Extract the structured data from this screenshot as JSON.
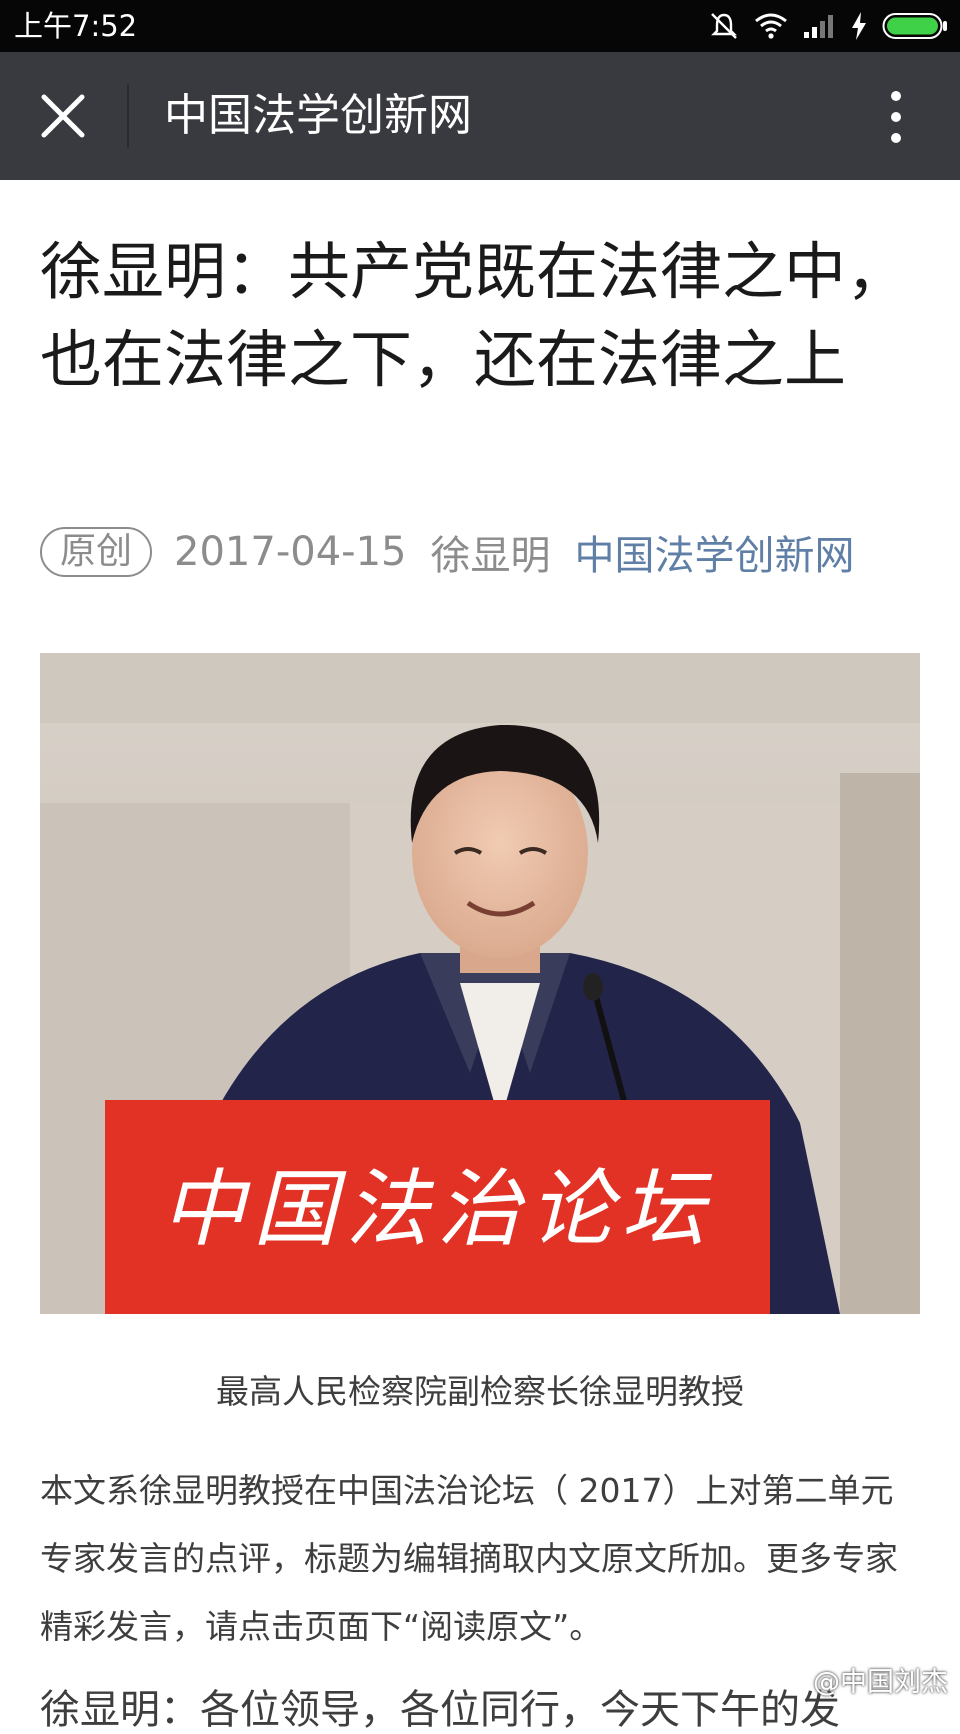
{
  "status_bar": {
    "time": "上午7:52",
    "icons": [
      "mute-vibrate-icon",
      "wifi-icon",
      "signal-icon",
      "charging-icon",
      "battery-icon"
    ],
    "battery_color": "#3fd147"
  },
  "header": {
    "title": "中国法学创新网",
    "background": "#393a3f",
    "icons": [
      "close-icon",
      "more-vertical-icon"
    ]
  },
  "article": {
    "title": "徐显明：共产党既在法律之中，也在法律之下，还在法律之上",
    "tag": "原创",
    "date": "2017-04-15",
    "author": "徐显明",
    "account": "中国法学创新网",
    "account_color": "#607fa6",
    "image": {
      "podium_text": "中国法治论坛",
      "podium_color": "#e23226"
    },
    "caption": "最高人民检察院副检察长徐显明教授",
    "intro": "本文系徐显明教授在中国法治论坛（ 2017）上对第二单元专家发言的点评，标题为编辑摘取内文原文所加。更多专家精彩发言，请点击页面下“阅读原文”。",
    "body_cut": "徐显明：各位领导，各位同行，今天下午的发"
  },
  "watermark": "@中国刘杰"
}
